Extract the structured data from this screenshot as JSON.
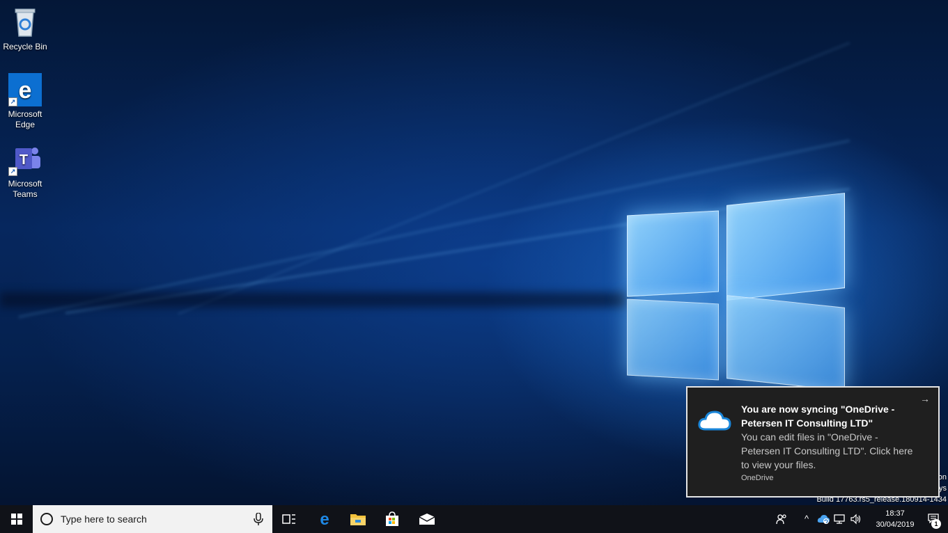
{
  "desktop": {
    "icons": [
      {
        "label": "Recycle Bin",
        "icon": "recycle-bin-icon"
      },
      {
        "label": "Microsoft Edge",
        "icon": "edge-icon"
      },
      {
        "label": "Microsoft Teams",
        "icon": "teams-icon"
      }
    ],
    "build_lines": [
      "on",
      "ys",
      "Build 17763.rs5_release.180914-1434"
    ]
  },
  "toast": {
    "title": "You are now syncing \"OneDrive - Petersen IT Consulting LTD\"",
    "body": "You can edit files in \"OneDrive - Petersen IT Consulting LTD\". Click here to view your files.",
    "source": "OneDrive",
    "expand_glyph": "→",
    "icon": "onedrive-cloud-icon"
  },
  "taskbar": {
    "search_placeholder": "Type here to search",
    "pinned": [
      "task-view-icon",
      "edge-icon",
      "file-explorer-icon",
      "store-icon",
      "mail-icon"
    ],
    "tray": {
      "people_icon": "people-icon",
      "chevron": "^",
      "time": "18:37",
      "date": "30/04/2019",
      "notification_count": "1"
    }
  },
  "colors": {
    "taskbar": "#101218",
    "toast_bg": "#1f1f1f",
    "accent": "#0078d7"
  }
}
